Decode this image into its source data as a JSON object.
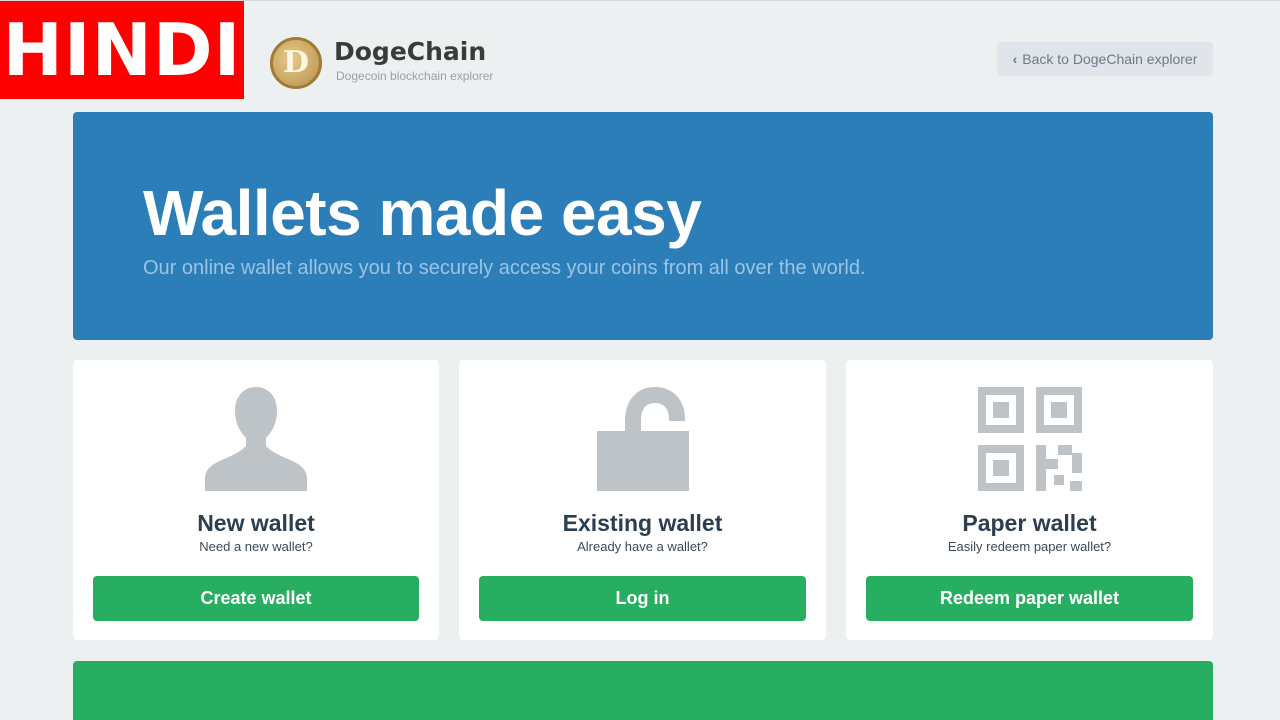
{
  "overlay": {
    "badge": "HINDI"
  },
  "header": {
    "brand_name": "DogeChain",
    "brand_tagline": "Dogecoin blockchain explorer",
    "logo_letter": "D",
    "back_label": "Back to DogeChain explorer"
  },
  "hero": {
    "title": "Wallets made easy",
    "subtitle": "Our online wallet allows you to securely access your coins from all over the world."
  },
  "cards": [
    {
      "icon": "user-icon",
      "title": "New wallet",
      "subtitle": "Need a new wallet?",
      "button": "Create wallet"
    },
    {
      "icon": "unlock-icon",
      "title": "Existing wallet",
      "subtitle": "Already have a wallet?",
      "button": "Log in"
    },
    {
      "icon": "qr-code-icon",
      "title": "Paper wallet",
      "subtitle": "Easily redeem paper wallet?",
      "button": "Redeem paper wallet"
    }
  ],
  "colors": {
    "hero": "#2b7eb8",
    "button": "#27ae60",
    "background": "#ecf0f1",
    "icon": "#bdc3c7",
    "badge": "#ff0000"
  }
}
